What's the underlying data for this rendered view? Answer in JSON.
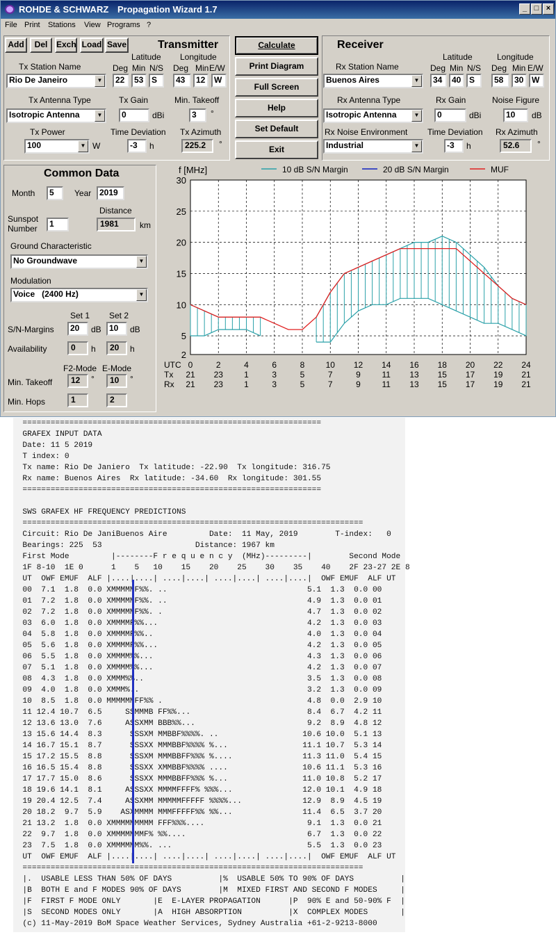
{
  "title": {
    "brand": "ROHDE & SCHWARZ",
    "app": "Propagation Wizard  1.7"
  },
  "menu": [
    "File",
    "Print",
    "Stations",
    "View",
    "Programs",
    "?"
  ],
  "tx": {
    "buttons": [
      "Add",
      "Del",
      "Exch",
      "Load",
      "Save"
    ],
    "heading": "Transmitter",
    "lat_label": "Latitude",
    "lon_label": "Longitude",
    "station_label": "Tx Station Name",
    "station": "Rio De Janeiro",
    "deg": "Deg",
    "min": "Min",
    "ns": "N/S",
    "ew": "E/W",
    "lat_deg": "22",
    "lat_min": "53",
    "lat_ns": "S",
    "lon_deg": "43",
    "lon_min": "12",
    "lon_ew": "W",
    "antenna_label": "Tx Antenna Type",
    "antenna": "Isotropic Antenna",
    "gain_label": "Tx Gain",
    "gain": "0",
    "gain_unit": "dBi",
    "takeoff_label": "Min. Takeoff",
    "takeoff": "3",
    "takeoff_unit": "°",
    "power_label": "Tx Power",
    "power": "100",
    "power_unit": "W",
    "timedev_label": "Time Deviation",
    "timedev": "-3",
    "timedev_unit": "h",
    "azimuth_label": "Tx Azimuth",
    "azimuth": "225.2",
    "azimuth_unit": "°"
  },
  "center_buttons": [
    "Calculate",
    "Print Diagram",
    "Full Screen",
    "Help",
    "Set Default",
    "Exit"
  ],
  "rx": {
    "heading": "Receiver",
    "lat_label": "Latitude",
    "lon_label": "Longitude",
    "station_label": "Rx Station Name",
    "station": "Buenos Aires",
    "deg": "Deg",
    "min": "Min",
    "ns": "N/S",
    "ew": "E/W",
    "lat_deg": "34",
    "lat_min": "40",
    "lat_ns": "S",
    "lon_deg": "58",
    "lon_min": "30",
    "lon_ew": "W",
    "antenna_label": "Rx Antenna Type",
    "antenna": "Isotropic Antenna",
    "gain_label": "Rx Gain",
    "gain": "0",
    "gain_unit": "dBi",
    "noise_label": "Noise Figure",
    "noise": "10",
    "noise_unit": "dB",
    "env_label": "Rx Noise Environment",
    "env": "Industrial",
    "timedev_label": "Time Deviation",
    "timedev": "-3",
    "timedev_unit": "h",
    "azimuth_label": "Rx Azimuth",
    "azimuth": "52.6",
    "azimuth_unit": "°"
  },
  "common": {
    "heading": "Common Data",
    "month_label": "Month",
    "month": "5",
    "year_label": "Year",
    "year": "2019",
    "distance_label": "Distance",
    "sunspot_label1": "Sunspot",
    "sunspot_label2": "Number",
    "sunspot": "1",
    "distance": "1981",
    "distance_unit": "km",
    "ground_label": "Ground Characteristic",
    "ground": "No Groundwave",
    "mod_label": "Modulation",
    "mod": "Voice   (2400 Hz)",
    "set1": "Set 1",
    "set2": "Set 2",
    "sn_label": "S/N-Margins",
    "sn1": "20",
    "sn2": "10",
    "db": "dB",
    "avail_label": "Availability",
    "avail1": "0",
    "avail2": "20",
    "h": "h",
    "f2": "F2-Mode",
    "emode": "E-Mode",
    "takeoff_label": "Min. Takeoff",
    "takeoff1": "12",
    "takeoff2": "10",
    "deg": "°",
    "hops_label": "Min. Hops",
    "hops1": "1",
    "hops2": "2"
  },
  "chart_data": {
    "type": "line",
    "ylabel": "f [MHz]",
    "legend": [
      "10 dB S/N Margin",
      "20 dB S/N Margin",
      "MUF"
    ],
    "colors": {
      "s10": "#2aa0a8",
      "s20": "#1020c0",
      "muf": "#e02020"
    },
    "ylim": [
      2,
      30
    ],
    "yticks": [
      2,
      5,
      10,
      15,
      20,
      25,
      30
    ],
    "xlim": [
      0,
      24
    ],
    "row_labels": [
      "UTC",
      "Tx",
      "Rx"
    ],
    "utc": [
      "0",
      "2",
      "4",
      "6",
      "8",
      "10",
      "12",
      "14",
      "16",
      "18",
      "20",
      "22",
      "24"
    ],
    "txrow": [
      "21",
      "23",
      "1",
      "3",
      "5",
      "7",
      "9",
      "11",
      "13",
      "15",
      "17",
      "19",
      "21"
    ],
    "rxrow": [
      "21",
      "23",
      "1",
      "3",
      "5",
      "7",
      "9",
      "11",
      "13",
      "15",
      "17",
      "19",
      "21"
    ],
    "muf": [
      [
        0,
        10
      ],
      [
        2,
        8
      ],
      [
        3,
        8
      ],
      [
        5,
        8
      ],
      [
        7,
        6
      ],
      [
        8,
        6
      ],
      [
        9,
        8
      ],
      [
        10,
        12
      ],
      [
        11,
        15
      ],
      [
        13,
        17
      ],
      [
        15,
        19
      ],
      [
        19,
        19
      ],
      [
        22,
        13
      ],
      [
        23,
        11
      ],
      [
        24,
        10
      ]
    ],
    "s10_segments": [
      {
        "hi": [
          [
            0,
            10
          ],
          [
            1,
            9
          ],
          [
            2,
            8
          ],
          [
            4,
            8
          ],
          [
            5,
            8
          ]
        ],
        "lo": [
          [
            0,
            5
          ],
          [
            1,
            5
          ],
          [
            2,
            6
          ],
          [
            4,
            6
          ],
          [
            5,
            5
          ]
        ]
      },
      {
        "hi": [
          [
            9,
            8
          ],
          [
            10,
            12
          ],
          [
            11,
            15
          ],
          [
            13,
            17
          ],
          [
            15,
            19
          ],
          [
            16,
            20
          ],
          [
            17,
            20
          ],
          [
            18,
            21
          ],
          [
            19,
            20
          ],
          [
            20,
            18
          ],
          [
            21,
            16
          ],
          [
            22,
            13
          ],
          [
            23,
            11
          ],
          [
            24,
            10
          ]
        ],
        "lo": [
          [
            9,
            4
          ],
          [
            10,
            4
          ],
          [
            11,
            7
          ],
          [
            12,
            9
          ],
          [
            13,
            10
          ],
          [
            14,
            10
          ],
          [
            15,
            11
          ],
          [
            17,
            11
          ],
          [
            18,
            10
          ],
          [
            19,
            9
          ],
          [
            20,
            8
          ],
          [
            21,
            7
          ],
          [
            22,
            7
          ],
          [
            23,
            6
          ],
          [
            24,
            5
          ]
        ]
      }
    ]
  },
  "report": [
    "================================================================",
    "GRAFEX INPUT DATA",
    "Date: 11 5 2019",
    "T index: 0",
    "Tx name: Rio De Janiero  Tx latitude: -22.90  Tx longitude: 316.75",
    "Rx name: Buenos Aires  Rx latitude: -34.60  Rx longitude: 301.55",
    "================================================================",
    "",
    "SWS GRAFEX HF FREQUENCY PREDICTIONS",
    "=========================================================================",
    "Circuit: Rio De JaniBuenos Aire         Date:  11 May, 2019        T-index:   0",
    "Bearings: 225  53                    Distance: 1967 km",
    "First Mode         |--------F r e q u e n c y  (MHz)---------|        Second Mode",
    "1F 8-10  1E 0      1    5   10    15    20    25    30    35    40    2F 23-27 2E 8",
    "UT  OWF EMUF  ALF |....|....| ....|....| ....|....| ....|....|  OWF EMUF  ALF UT",
    "00  7.1  1.8  0.0 XMMMMMF%%. ..                              5.1  1.3  0.0 00",
    "01  7.2  1.8  0.0 XMMMMMF%%. ..                              4.9  1.3  0.0 01",
    "02  7.2  1.8  0.0 XMMMMMF%%. .                               4.7  1.3  0.0 02",
    "03  6.0  1.8  0.0 XMMMMF%%...                                4.2  1.3  0.0 03",
    "04  5.8  1.8  0.0 XMMMMF%%..                                 4.0  1.3  0.0 04",
    "05  5.6  1.8  0.0 XMMMMF%%...                                4.2  1.3  0.0 05",
    "06  5.5  1.8  0.0 XMMMM%%...                                 4.3  1.3  0.0 06",
    "07  5.1  1.8  0.0 XMMMM%%...                                 4.2  1.3  0.0 07",
    "08  4.3  1.8  0.0 XMMM%%..                                   3.5  1.3  0.0 08",
    "09  4.0  1.8  0.0 XMMM%..                                    3.2  1.3  0.0 09",
    "10  8.5  1.8  0.0 MMMMMMFF%% .                               4.8  0.0  2.9 10",
    "11 12.4 10.7  6.5     SSMMMB FF%%...                         8.4  6.7  4.2 11",
    "12 13.6 13.0  7.6     ASSXMM BBB%%...                        9.2  8.9  4.8 12",
    "13 15.6 14.4  8.3      SSSXM MMBBF%%%%. ..                  10.6 10.0  5.1 13",
    "14 16.7 15.1  8.7      SSSXX MMMBBF%%%% %...                11.1 10.7  5.3 14",
    "15 17.2 15.5  8.8      SSSXM MMMBBFF%%% %....               11.3 11.0  5.4 15",
    "16 16.5 15.4  8.8      SSSXX XMMBBF%%%% ....                10.6 11.1  5.3 16",
    "17 17.7 15.0  8.6      SSSXX MMMBBFF%%% %...                11.0 10.8  5.2 17",
    "18 19.6 14.1  8.1     ASSSXX MMMMFFFF% %%%...               12.0 10.1  4.9 18",
    "19 20.4 12.5  7.4     ASSXMM MMMMMFFFFF %%%%...             12.9  8.9  4.5 19",
    "20 18.2  9.7  5.9    ASXMMMM MMMFFFFF%% %%...               11.4  6.5  3.7 20",
    "21 13.2  1.8  0.0 XMMMMMMMMM FFF%%%....                      9.1  1.3  0.0 21",
    "22  9.7  1.8  0.0 XMMMMMMMF% %%....                          6.7  1.3  0.0 22",
    "23  7.5  1.8  0.0 XMMMMMM%%. ...                             5.5  1.3  0.0 23",
    "UT  OWF EMUF  ALF |....|....| ....|....| ....|....| ....|....|  OWF EMUF  ALF UT",
    "=========================================================================",
    "|.  USABLE LESS THAN 50% OF DAYS          |%  USABLE 50% TO 90% OF DAYS          |",
    "|B  BOTH E and F MODES 90% OF DAYS        |M  MIXED FIRST AND SECOND F MODES     |",
    "|F  FIRST F MODE ONLY       |E  E-LAYER PROPAGATION      |P  90% E and 50-90% F  |",
    "|S  SECOND MODES ONLY       |A  HIGH ABSORPTION          |X  COMPLEX MODES       |",
    "(c) 11-May-2019 BoM Space Weather Services, Sydney Australia +61-2-9213-8000"
  ]
}
